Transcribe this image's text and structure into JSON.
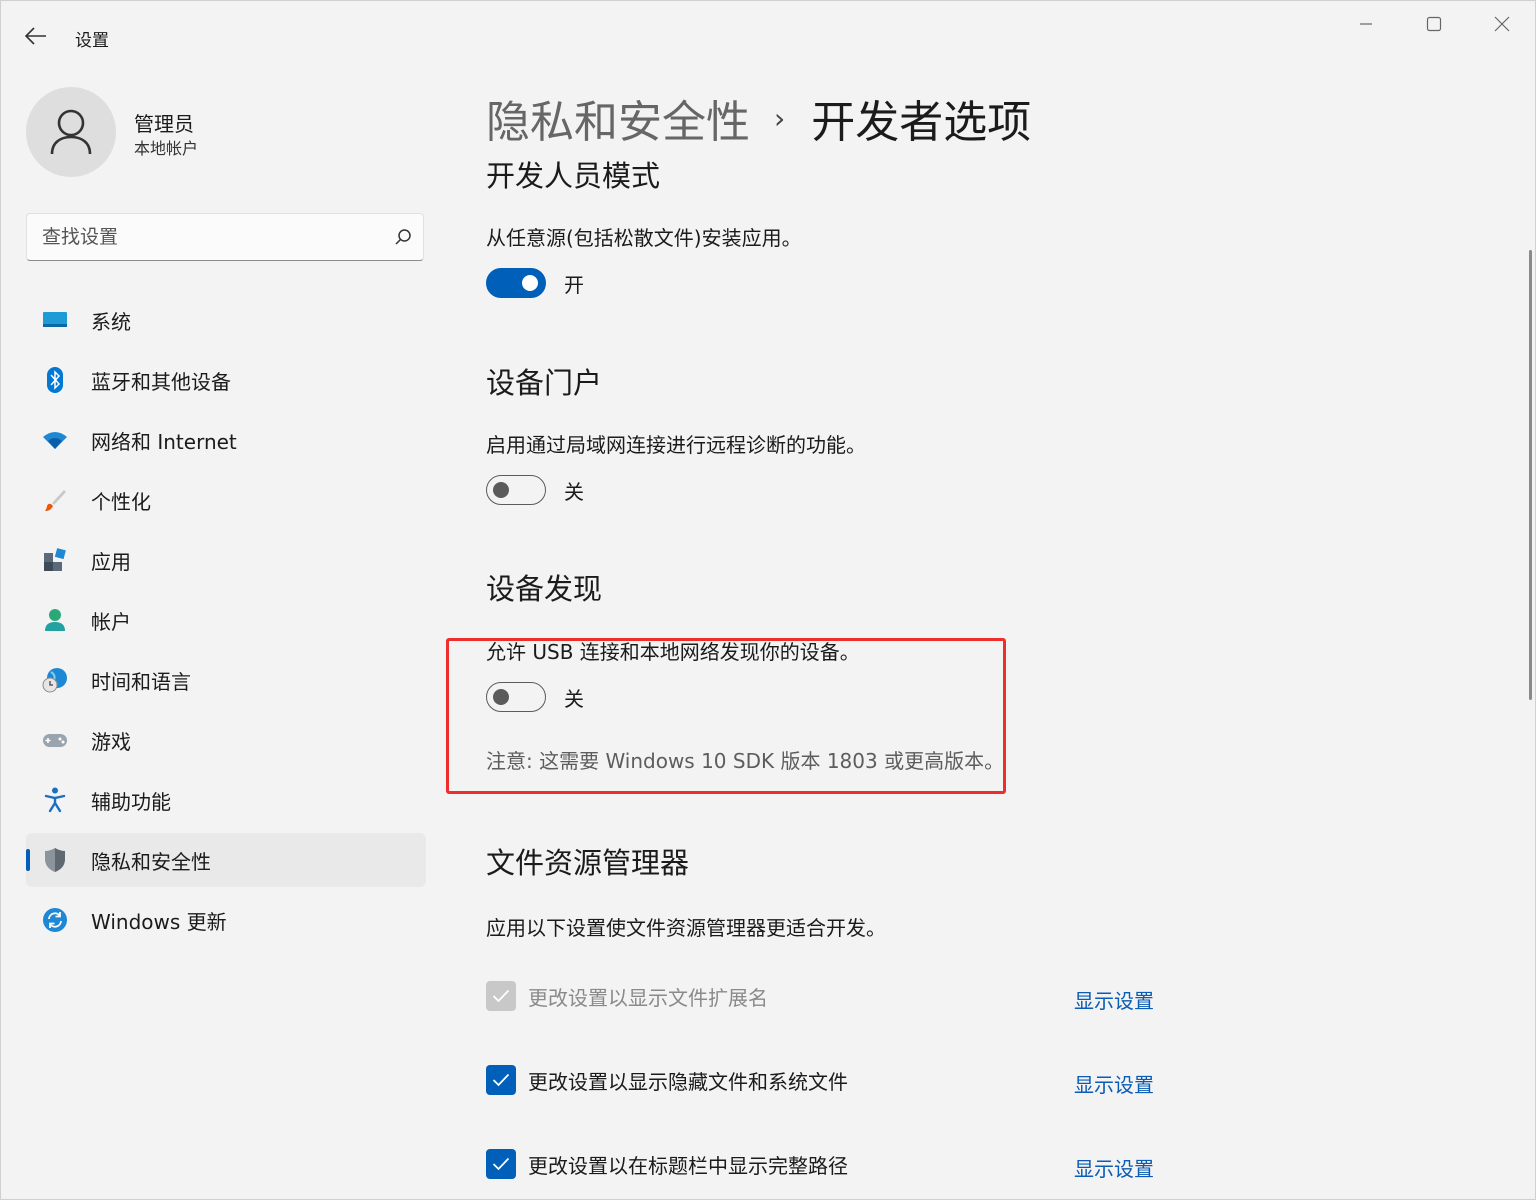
{
  "window": {
    "title": "设置"
  },
  "profile": {
    "name": "管理员",
    "account_type": "本地帐户"
  },
  "search": {
    "placeholder": "查找设置"
  },
  "nav": {
    "items": [
      {
        "label": "系统",
        "icon": "monitor-icon"
      },
      {
        "label": "蓝牙和其他设备",
        "icon": "bluetooth-icon"
      },
      {
        "label": "网络和 Internet",
        "icon": "wifi-icon"
      },
      {
        "label": "个性化",
        "icon": "brush-icon"
      },
      {
        "label": "应用",
        "icon": "apps-icon"
      },
      {
        "label": "帐户",
        "icon": "account-icon"
      },
      {
        "label": "时间和语言",
        "icon": "globe-clock-icon"
      },
      {
        "label": "游戏",
        "icon": "gamepad-icon"
      },
      {
        "label": "辅助功能",
        "icon": "accessibility-icon"
      },
      {
        "label": "隐私和安全性",
        "icon": "shield-icon",
        "active": true
      },
      {
        "label": "Windows 更新",
        "icon": "update-icon"
      }
    ]
  },
  "breadcrumb": {
    "parent": "隐私和安全性",
    "separator": "›",
    "current": "开发者选项"
  },
  "developer_mode": {
    "title": "开发人员模式",
    "description": "从任意源(包括松散文件)安装应用。",
    "toggle_state": "on",
    "toggle_label": "开"
  },
  "device_portal": {
    "title": "设备门户",
    "description": "启用通过局域网连接进行远程诊断的功能。",
    "toggle_state": "off",
    "toggle_label": "关"
  },
  "device_discovery": {
    "title": "设备发现",
    "description": "允许 USB 连接和本地网络发现你的设备。",
    "toggle_state": "off",
    "toggle_label": "关",
    "note": "注意: 这需要 Windows 10 SDK 版本 1803 或更高版本。"
  },
  "file_explorer": {
    "title": "文件资源管理器",
    "description": "应用以下设置使文件资源管理器更适合开发。",
    "options": [
      {
        "label": "更改设置以显示文件扩展名",
        "checked": true,
        "disabled": true,
        "link": "显示设置"
      },
      {
        "label": "更改设置以显示隐藏文件和系统文件",
        "checked": true,
        "disabled": false,
        "link": "显示设置"
      },
      {
        "label": "更改设置以在标题栏中显示完整路径",
        "checked": true,
        "disabled": false,
        "link": "显示设置"
      }
    ]
  },
  "colors": {
    "accent": "#005fb8",
    "highlight": "#ef2d2d",
    "background": "#f3f3f3"
  }
}
